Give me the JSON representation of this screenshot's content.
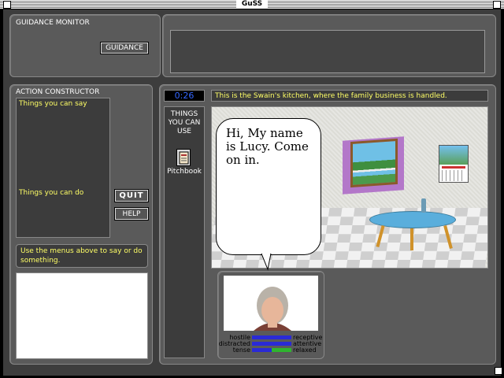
{
  "window": {
    "title": "GuSS"
  },
  "guidance_monitor": {
    "heading": "GUIDANCE MONITOR",
    "button_label": "GUIDANCE"
  },
  "action_constructor": {
    "heading": "ACTION CONSTRUCTOR",
    "say_label": "Things you can say",
    "do_label": "Things you can do",
    "quit_label": "QUIT",
    "help_label": "HELP",
    "hint": "Use the menus above to say or do something."
  },
  "scene": {
    "timer": "0:26",
    "description": "This is the Swain's kitchen, where the family business is handled.",
    "things_heading": "THINGS YOU CAN USE",
    "items": [
      {
        "label": "Pitchbook",
        "icon": "pitchbook-icon"
      }
    ],
    "speech": "Hi, My name is Lucy. Come on in."
  },
  "character": {
    "mood": [
      {
        "left": "hostile",
        "right": "receptive",
        "value": 0.5
      },
      {
        "left": "distracted",
        "right": "attentive",
        "value": 0.55
      },
      {
        "left": "tense",
        "right": "relaxed",
        "value": 0.5
      }
    ]
  },
  "colors": {
    "accent_yellow": "#ffff66",
    "mood_bar": "#2a2ad6",
    "timer_text": "#3366ff"
  }
}
